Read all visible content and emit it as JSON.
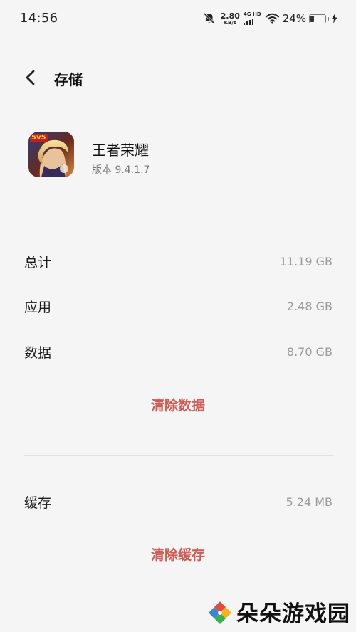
{
  "status_bar": {
    "time": "14:56",
    "net_speed_value": "2.80",
    "net_speed_unit": "KB/s",
    "network_type": "4G HD",
    "battery_percent": "24%",
    "battery_level": 0.24
  },
  "header": {
    "title": "存储"
  },
  "app": {
    "name": "王者荣耀",
    "version": "版本 9.4.1.7",
    "icon_badge": "5v5"
  },
  "storage": {
    "total_label": "总计",
    "total_value": "11.19 GB",
    "app_label": "应用",
    "app_value": "2.48 GB",
    "data_label": "数据",
    "data_value": "8.70 GB",
    "clear_data": "清除数据",
    "cache_label": "缓存",
    "cache_value": "5.24 MB",
    "clear_cache": "清除缓存"
  },
  "watermark": {
    "text": "朵朵游戏园"
  },
  "colors": {
    "accent": "#cf5b55",
    "background": "#f5f5f5"
  }
}
